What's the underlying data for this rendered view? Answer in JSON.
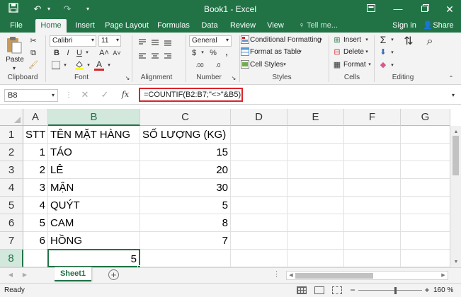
{
  "window": {
    "title": "Book1 - Excel"
  },
  "quick_access": {
    "save_icon": "save-icon",
    "undo_icon": "undo-icon",
    "redo_icon": "redo-icon",
    "customize_icon": "customize-icon"
  },
  "window_controls": {
    "ribbon_options": "ribbon-display-icon",
    "minimize": "minimize-icon",
    "restore": "restore-icon",
    "close": "close-icon"
  },
  "tabs": [
    {
      "label": "File"
    },
    {
      "label": "Home"
    },
    {
      "label": "Insert"
    },
    {
      "label": "Page Layout"
    },
    {
      "label": "Formulas"
    },
    {
      "label": "Data"
    },
    {
      "label": "Review"
    },
    {
      "label": "View"
    },
    {
      "label": "Tell me..."
    }
  ],
  "account": {
    "sign_in": "Sign in",
    "share": "Share"
  },
  "ribbon": {
    "clipboard": {
      "label": "Clipboard",
      "paste": "Paste"
    },
    "font": {
      "label": "Font",
      "font_name": "Calibri",
      "font_size": "11",
      "bold": "B",
      "italic": "I",
      "underline": "U",
      "grow": "A˄",
      "shrink": "A˅",
      "font_color": "A"
    },
    "alignment": {
      "label": "Alignment"
    },
    "number": {
      "label": "Number",
      "format": "General",
      "currency": "$",
      "percent": "%",
      "comma": ",",
      "inc_decimal": ".00",
      "dec_decimal": ".0"
    },
    "styles": {
      "label": "Styles",
      "conditional": "Conditional Formatting",
      "format_table": "Format as Table",
      "cell_styles": "Cell Styles"
    },
    "cells": {
      "label": "Cells",
      "insert": "Insert",
      "delete": "Delete",
      "format": "Format"
    },
    "editing": {
      "label": "Editing"
    }
  },
  "formula_bar": {
    "name_box": "B8",
    "cancel": "✕",
    "enter": "✓",
    "fx": "fx",
    "formula": "=COUNTIF(B2:B7;\"<>\"&B5)"
  },
  "columns": [
    "A",
    "B",
    "C",
    "D",
    "E",
    "F",
    "G"
  ],
  "rows": [
    "1",
    "2",
    "3",
    "4",
    "5",
    "6",
    "7",
    "8"
  ],
  "cells": {
    "A1": "STT",
    "B1": "TÊN MẶT HÀNG",
    "C1": "SỐ LƯỢNG (KG)",
    "A2": "1",
    "B2": "TÁO",
    "C2": "15",
    "A3": "2",
    "B3": "LÊ",
    "C3": "20",
    "A4": "3",
    "B4": "MẬN",
    "C4": "30",
    "A5": "4",
    "B5": "QUÝT",
    "C5": "5",
    "A6": "5",
    "B6": "CAM",
    "C6": "8",
    "A7": "6",
    "B7": "HỒNG",
    "C7": "7",
    "B8": "5"
  },
  "sheet_tabs": [
    {
      "label": "Sheet1"
    }
  ],
  "status": {
    "ready": "Ready",
    "zoom": "160 %",
    "minus": "−",
    "plus": "+"
  },
  "colors": {
    "excel_green": "#217346",
    "formula_highlight": "#d9252a"
  }
}
